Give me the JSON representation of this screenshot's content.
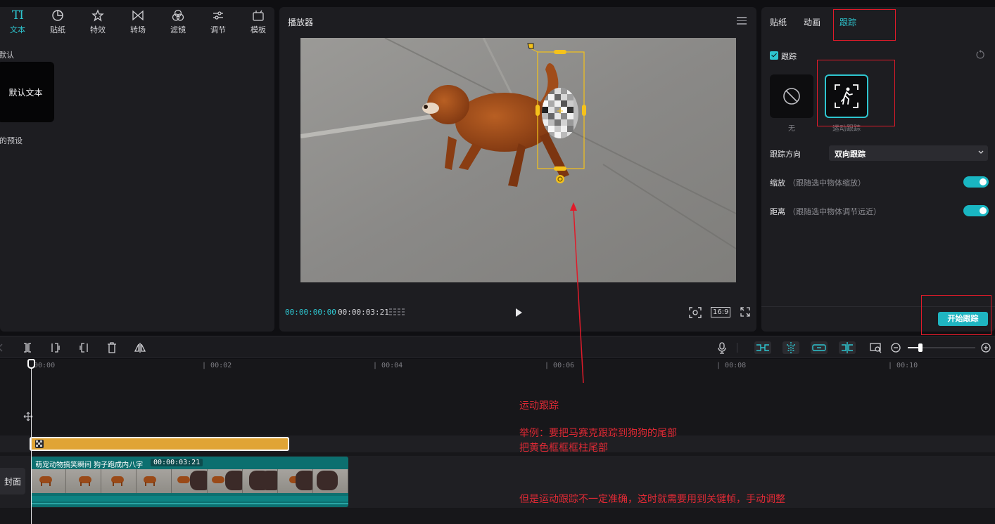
{
  "left_panel": {
    "tabs": [
      {
        "label": "文本",
        "icon": "text-icon",
        "active": true
      },
      {
        "label": "贴纸",
        "icon": "sticker-icon"
      },
      {
        "label": "特效",
        "icon": "effects-icon"
      },
      {
        "label": "转场",
        "icon": "transition-icon"
      },
      {
        "label": "滤镜",
        "icon": "filter-icon"
      },
      {
        "label": "调节",
        "icon": "adjust-icon"
      },
      {
        "label": "模板",
        "icon": "template-icon"
      }
    ],
    "text_glyph": "TI",
    "section_default": "默认",
    "default_card": "默认文本",
    "section_presets": "我的预设"
  },
  "player": {
    "title": "播放器",
    "current_time": "00:00:00:00",
    "total_time": "00:00:03:21",
    "aspect_ratio": "16:9"
  },
  "right_panel": {
    "tabs": [
      {
        "label": "贴纸"
      },
      {
        "label": "动画"
      },
      {
        "label": "跟踪",
        "active": true
      }
    ],
    "tracking_label": "跟踪",
    "option_none": "无",
    "option_motion": "运动跟踪",
    "direction_label": "跟踪方向",
    "direction_value": "双向跟踪",
    "scale_label": "缩放",
    "scale_hint": "（跟随选中物体缩放）",
    "distance_label": "距离",
    "distance_hint": "（跟随选中物体调节远近）",
    "start_button": "开始跟踪",
    "scale_on": true,
    "distance_on": true
  },
  "timeline": {
    "ticks": [
      "00:00",
      "00:02",
      "00:04",
      "00:06",
      "00:08",
      "00:10"
    ],
    "video_clip_title": "萌宠动物搞笑瞬间 狗子跑成内八字",
    "video_clip_duration": "00:00:03:21",
    "cover_label": "封面"
  },
  "annotations": {
    "line1": "运动跟踪",
    "line2": "举例：要把马赛克跟踪到狗狗的尾部",
    "line3": "把黄色框框框柱尾部",
    "line4": "但是运动跟踪不一定准确，这时就需要用到关键帧，手动调整"
  },
  "colors": {
    "accent": "#2ec5cf",
    "annotation_red": "#e01b2a",
    "sticker_clip": "#e0a435",
    "video_clip": "#0c6f6f"
  }
}
